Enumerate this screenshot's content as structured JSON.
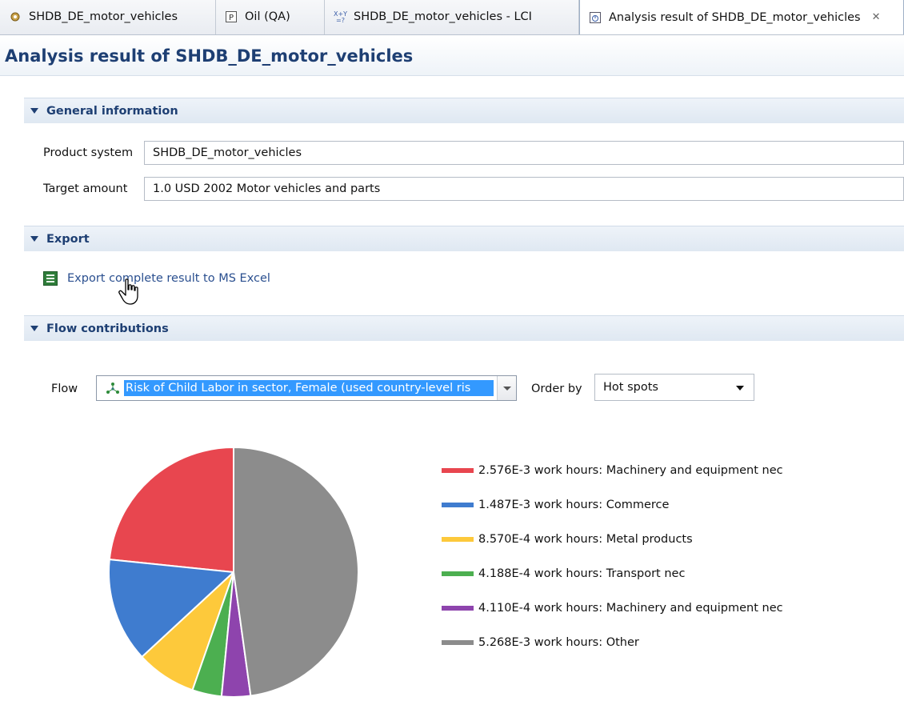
{
  "tabs": [
    {
      "label": "SHDB_DE_motor_vehicles",
      "icon": "gear-icon",
      "active": false
    },
    {
      "label": "Oil (QA)",
      "icon": "parameter-icon",
      "active": false
    },
    {
      "label": "SHDB_DE_motor_vehicles - LCI",
      "icon": "formula-icon",
      "active": false
    },
    {
      "label": "Analysis result of SHDB_DE_motor_vehicles",
      "icon": "analysis-icon",
      "active": true
    }
  ],
  "page": {
    "title": "Analysis result of SHDB_DE_motor_vehicles"
  },
  "general_info": {
    "header": "General information",
    "product_system_label": "Product system",
    "product_system_value": "SHDB_DE_motor_vehicles",
    "target_amount_label": "Target amount",
    "target_amount_value": "1.0 USD 2002 Motor vehicles and parts"
  },
  "export": {
    "header": "Export",
    "link_label": "Export complete result to MS Excel"
  },
  "flow_contributions": {
    "header": "Flow contributions",
    "flow_label": "Flow",
    "flow_value": "Risk of Child Labor in sector, Female (used country-level ris",
    "order_by_label": "Order by",
    "order_by_value": "Hot spots"
  },
  "chart_data": {
    "type": "pie",
    "title": "",
    "slices": [
      {
        "label": "2.576E-3 work hours: Machinery and equipment nec",
        "value": 0.002576,
        "color": "#e8464f"
      },
      {
        "label": "1.487E-3 work hours: Commerce",
        "value": 0.001487,
        "color": "#3f7ccf"
      },
      {
        "label": "8.570E-4 work hours: Metal products",
        "value": 0.000857,
        "color": "#fdc93b"
      },
      {
        "label": "4.188E-4 work hours: Transport nec",
        "value": 0.0004188,
        "color": "#4caf50"
      },
      {
        "label": "4.110E-4 work hours: Machinery and equipment nec",
        "value": 0.000411,
        "color": "#8e44ad"
      },
      {
        "label": "5.268E-3 work hours: Other",
        "value": 0.005268,
        "color": "#8c8c8c"
      }
    ],
    "legend_position": "right"
  }
}
